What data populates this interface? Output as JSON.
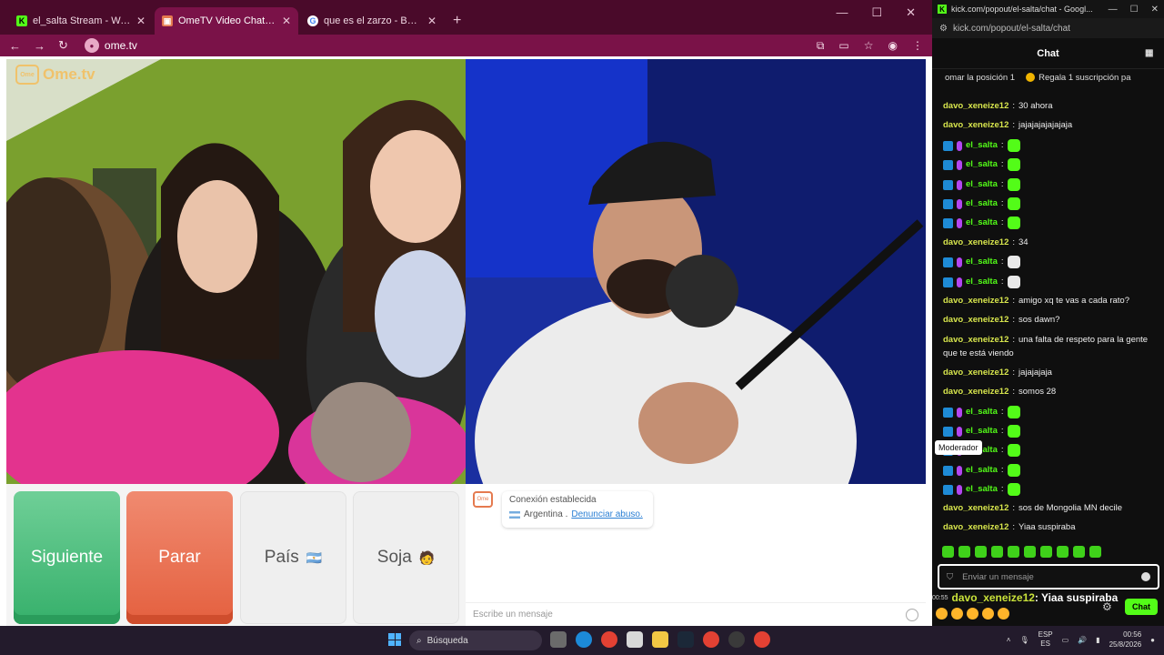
{
  "browser_tabs": [
    {
      "title": "el_salta Stream - Watch Live on Kick",
      "favicon": "kick-icon",
      "color": "#53fc18"
    },
    {
      "title": "OmeTV Video Chat — Alternative",
      "favicon": "ometv-icon",
      "color": "#e57a4f"
    },
    {
      "title": "que es el zarzo - Buscar con Google",
      "favicon": "google-icon",
      "color": "#4285f4"
    }
  ],
  "url": "ome.tv",
  "ometv": {
    "logo_text": "Ome.tv",
    "buttons": {
      "next": "Siguiente",
      "stop": "Parar",
      "country": "País",
      "gender": "Soja"
    },
    "connection_text": "Conexión establecida",
    "country_name": "Argentina .",
    "report_link": "Denunciar abuso.",
    "message_placeholder": "Escribe un mensaje"
  },
  "kick": {
    "window_title": "kick.com/popout/el-salta/chat - Googl...",
    "url": "kick.com/popout/el-salta/chat",
    "chat_header": "Chat",
    "pinned": [
      "omar la posición 1",
      "Regala 1 suscripción pa"
    ],
    "messages": [
      {
        "user": "davo_xeneize12",
        "text": "30 ahora"
      },
      {
        "user": "davo_xeneize12",
        "text": "jajajajajajajaja"
      },
      {
        "user": "el_salta",
        "text": ""
      },
      {
        "user": "el_salta",
        "text": ""
      },
      {
        "user": "el_salta",
        "text": ""
      },
      {
        "user": "el_salta",
        "text": ""
      },
      {
        "user": "el_salta",
        "text": ""
      },
      {
        "user": "davo_xeneize12",
        "text": "34"
      },
      {
        "user": "el_salta",
        "text": ""
      },
      {
        "user": "el_salta",
        "text": ""
      },
      {
        "user": "davo_xeneize12",
        "text": "amigo xq te vas a cada rato?"
      },
      {
        "user": "davo_xeneize12",
        "text": "sos dawn?"
      },
      {
        "user": "davo_xeneize12",
        "text": "una falta de respeto para la gente"
      },
      {
        "user": "",
        "text": "que te está viendo"
      },
      {
        "user": "davo_xeneize12",
        "text": "jajajajaja"
      },
      {
        "user": "davo_xeneize12",
        "text": "somos 28"
      },
      {
        "user": "el_salta",
        "text": ""
      },
      {
        "user": "el_salta",
        "text": ""
      },
      {
        "user": "el_salta",
        "text": ""
      },
      {
        "user": "el_salta",
        "text": ""
      },
      {
        "user": "el_salta",
        "text": ""
      },
      {
        "user": "davo_xeneize12",
        "text": "sos de Mongolia MN decile"
      },
      {
        "user": "davo_xeneize12",
        "text": "Yiaa suspiraba"
      }
    ],
    "tooltip": "Moderador",
    "input_placeholder": "Enviar un mensaje",
    "chat_button": "Chat",
    "overlay_time": "00:55",
    "overlay_user": "davo_xeneize12",
    "overlay_text": ": Yiaa suspiraba"
  },
  "taskbar": {
    "search_label": "Búsqueda",
    "lang": "ESP",
    "lang_sub": "ES",
    "time": "00:56",
    "date": "25/8/2026"
  }
}
